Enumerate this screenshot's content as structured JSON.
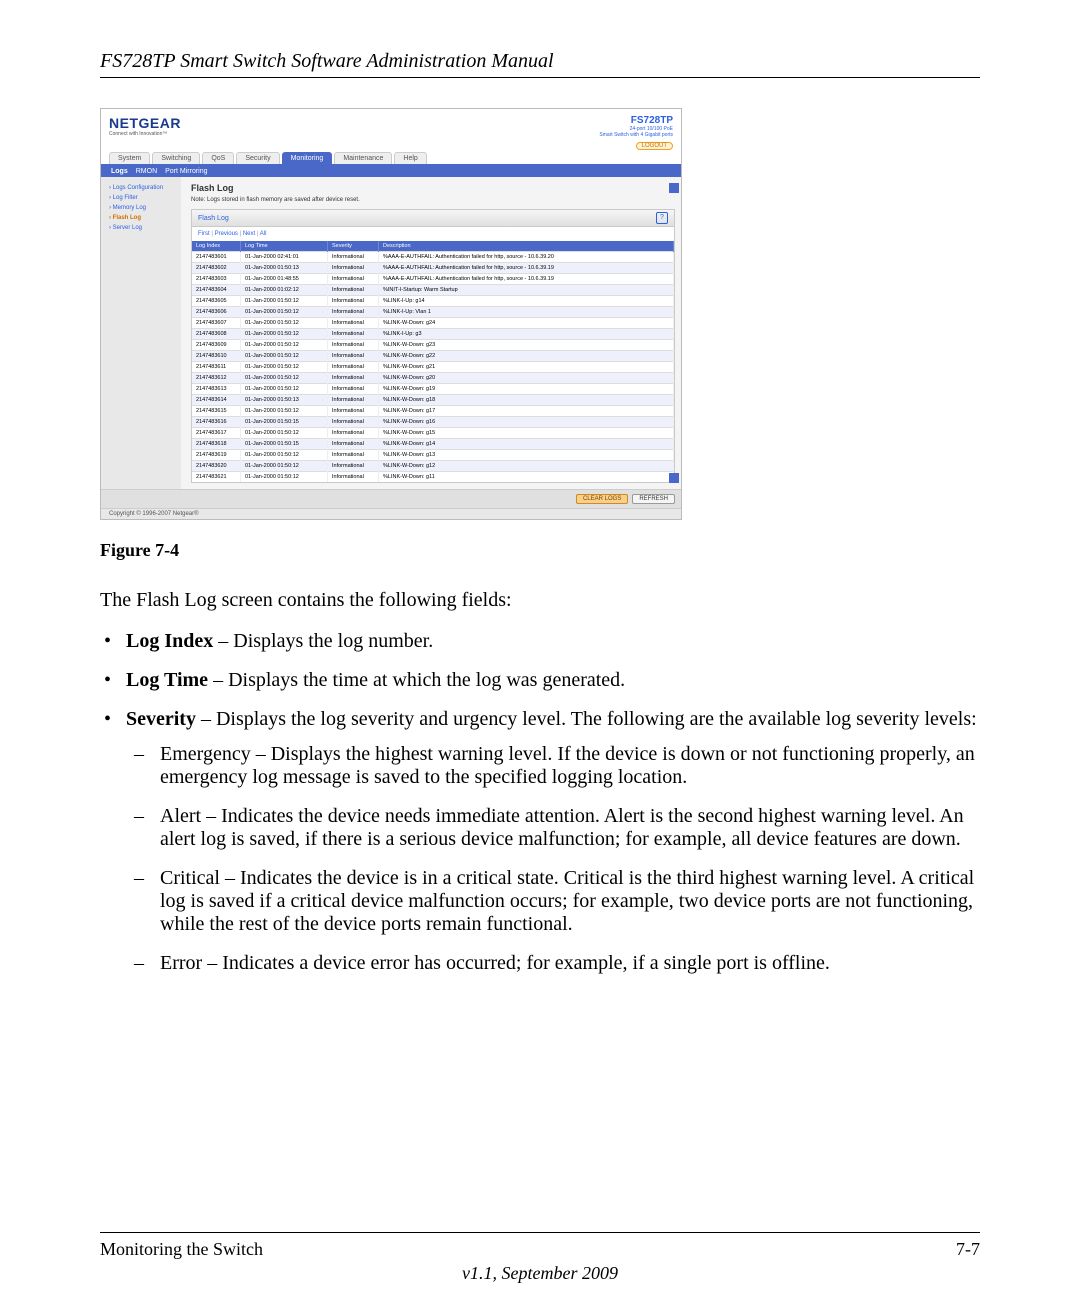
{
  "doc": {
    "header": "FS728TP Smart Switch Software Administration Manual",
    "figure_caption": "Figure 7-4",
    "intro": "The Flash Log screen contains the following fields:",
    "footer_left": "Monitoring the Switch",
    "footer_right": "7-7",
    "footer_center": "v1.1, September 2009"
  },
  "fields": [
    {
      "name": "Log Index",
      "desc": " – Displays the log number."
    },
    {
      "name": "Log Time",
      "desc": " – Displays the time at which the log was generated."
    },
    {
      "name": "Severity",
      "desc": " – Displays the log severity and urgency level. The following are the available log severity levels:"
    }
  ],
  "severity_levels": [
    "Emergency – Displays the highest warning level. If the device is down or not functioning properly, an emergency log message is saved to the specified logging location.",
    "Alert – Indicates the device needs immediate attention. Alert is the second highest warning level. An alert log is saved, if there is a serious device malfunction; for example, all device features are down.",
    "Critical – Indicates the device is in a critical state. Critical is the third highest warning level. A critical log is saved if a critical device malfunction occurs; for example, two device ports are not functioning, while the rest of the device ports remain functional.",
    "Error – Indicates a device error has occurred; for example, if a single port is offline."
  ],
  "ui": {
    "brand": "NETGEAR",
    "tagline": "Connect with Innovation™",
    "model": "FS728TP",
    "model_sub1": "24-port 10/100 PoE",
    "model_sub2": "Smart Switch with 4 Gigabit ports",
    "logout": "LOGOUT",
    "tabs": [
      "System",
      "Switching",
      "QoS",
      "Security",
      "Monitoring",
      "Maintenance",
      "Help"
    ],
    "active_tab": "Monitoring",
    "subtabs": [
      "Logs",
      "RMON",
      "Port Mirroring"
    ],
    "active_subtab": "Logs",
    "side_items": [
      "Logs Configuration",
      "Log Filter",
      "Memory Log",
      "Flash Log",
      "Server Log"
    ],
    "active_side": "Flash Log",
    "panel_title": "Flash Log",
    "note": "Note: Logs stored in flash memory are saved after device reset.",
    "inner_title": "Flash Log",
    "pager": {
      "first": "First",
      "previous": "Previous",
      "next": "Next",
      "all": "All",
      "sep": " | "
    },
    "columns": [
      "Log Index",
      "Log Time",
      "Severity",
      "Description"
    ],
    "buttons": {
      "clear": "CLEAR LOGS",
      "refresh": "REFRESH"
    },
    "copyright": "Copyright © 1996-2007 Netgear®",
    "rows": [
      {
        "idx": "2147483601",
        "time": "01-Jan-2000 02:41:01",
        "sev": "Informational",
        "desc": "%AAA-E-AUTHFAIL: Authentication failed for http, source - 10.6.39.20"
      },
      {
        "idx": "2147483602",
        "time": "01-Jan-2000 01:50:13",
        "sev": "Informational",
        "desc": "%AAA-E-AUTHFAIL: Authentication failed for http, source - 10.6.39.19"
      },
      {
        "idx": "2147483603",
        "time": "01-Jan-2000 01:48:55",
        "sev": "Informational",
        "desc": "%AAA-E-AUTHFAIL: Authentication failed for http, source - 10.6.39.19"
      },
      {
        "idx": "2147483604",
        "time": "01-Jan-2000 01:02:12",
        "sev": "Informational",
        "desc": "%INIT-I-Startup: Warm Startup"
      },
      {
        "idx": "2147483605",
        "time": "01-Jan-2000 01:50:12",
        "sev": "Informational",
        "desc": "%LINK-I-Up: g14"
      },
      {
        "idx": "2147483606",
        "time": "01-Jan-2000 01:50:12",
        "sev": "Informational",
        "desc": "%LINK-I-Up: Vlan 1"
      },
      {
        "idx": "2147483607",
        "time": "01-Jan-2000 01:50:12",
        "sev": "Informational",
        "desc": "%LINK-W-Down: g24"
      },
      {
        "idx": "2147483608",
        "time": "01-Jan-2000 01:50:12",
        "sev": "Informational",
        "desc": "%LINK-I-Up: g3"
      },
      {
        "idx": "2147483609",
        "time": "01-Jan-2000 01:50:12",
        "sev": "Informational",
        "desc": "%LINK-W-Down: g23"
      },
      {
        "idx": "2147483610",
        "time": "01-Jan-2000 01:50:12",
        "sev": "Informational",
        "desc": "%LINK-W-Down: g22"
      },
      {
        "idx": "2147483611",
        "time": "01-Jan-2000 01:50:12",
        "sev": "Informational",
        "desc": "%LINK-W-Down: g21"
      },
      {
        "idx": "2147483612",
        "time": "01-Jan-2000 01:50:12",
        "sev": "Informational",
        "desc": "%LINK-W-Down: g20"
      },
      {
        "idx": "2147483613",
        "time": "01-Jan-2000 01:50:12",
        "sev": "Informational",
        "desc": "%LINK-W-Down: g19"
      },
      {
        "idx": "2147483614",
        "time": "01-Jan-2000 01:50:13",
        "sev": "Informational",
        "desc": "%LINK-W-Down: g18"
      },
      {
        "idx": "2147483615",
        "time": "01-Jan-2000 01:50:12",
        "sev": "Informational",
        "desc": "%LINK-W-Down: g17"
      },
      {
        "idx": "2147483616",
        "time": "01-Jan-2000 01:50:15",
        "sev": "Informational",
        "desc": "%LINK-W-Down: g16"
      },
      {
        "idx": "2147483617",
        "time": "01-Jan-2000 01:50:12",
        "sev": "Informational",
        "desc": "%LINK-W-Down: g15"
      },
      {
        "idx": "2147483618",
        "time": "01-Jan-2000 01:50:15",
        "sev": "Informational",
        "desc": "%LINK-W-Down: g14"
      },
      {
        "idx": "2147483619",
        "time": "01-Jan-2000 01:50:12",
        "sev": "Informational",
        "desc": "%LINK-W-Down: g13"
      },
      {
        "idx": "2147483620",
        "time": "01-Jan-2000 01:50:12",
        "sev": "Informational",
        "desc": "%LINK-W-Down: g12"
      },
      {
        "idx": "2147483621",
        "time": "01-Jan-2000 01:50:12",
        "sev": "Informational",
        "desc": "%LINK-W-Down: g11"
      }
    ]
  }
}
